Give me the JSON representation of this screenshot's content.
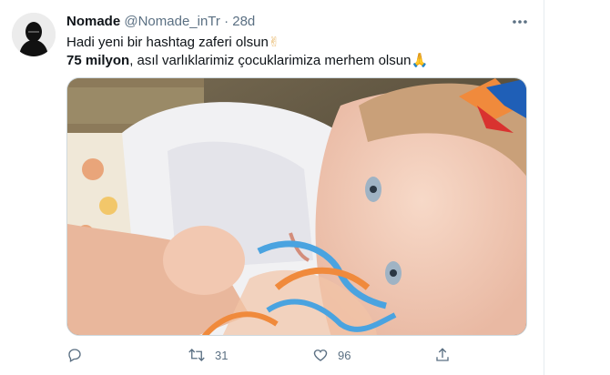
{
  "tweet": {
    "author_name": "Nomade",
    "handle": "@Nomade_inTr",
    "separator": "·",
    "time": "28d",
    "line1_text": "Hadi yeni bir hashtag zaferi olsun",
    "line1_emoji": "✌",
    "line2_bold": "75 milyon",
    "line2_text": ", asıl varlıklarimiz çocuklarimiza merhem olsun",
    "line2_emoji": "🙏"
  },
  "actions": {
    "retweets": "31",
    "likes": "96"
  },
  "icons": [
    "reply-icon",
    "retweet-icon",
    "like-icon",
    "share-icon",
    "more-icon"
  ],
  "colors": {
    "secondary_text": "#5b7083",
    "primary_text": "#0f1419",
    "border": "#e6ecf0"
  }
}
